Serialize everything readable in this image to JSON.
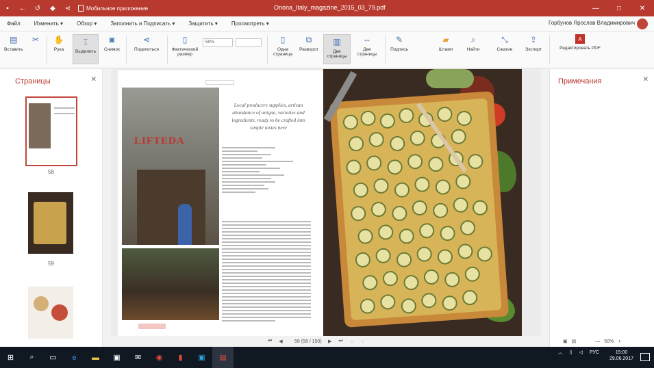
{
  "titlebar": {
    "icons": [
      "save-icon",
      "back-icon",
      "undo-icon",
      "shield-icon",
      "share-icon"
    ],
    "mobile_mode": "Мобильное приложение",
    "title": "Onona_Italy_magazine_2015_03_79.pdf",
    "buttons": [
      "—",
      "□",
      "✕"
    ]
  },
  "menu": {
    "items": [
      "Файл",
      "Изменить ▾",
      "Обзор ▾",
      "Заполнить и Подписать ▾",
      "Защитить ▾",
      "Просмотреть ▾"
    ],
    "user_name": "Горбунов Ярослав Владимирович"
  },
  "ribbon": {
    "buttons": [
      {
        "label": "Вставить",
        "icon": "paste-icon"
      },
      {
        "label": "",
        "icon": "cut-icon"
      },
      {
        "label": "Рука",
        "icon": "hand-icon"
      },
      {
        "label": "Выделить",
        "icon": "select-icon"
      },
      {
        "label": "Снимок",
        "icon": "camera-icon"
      },
      {
        "label": "Поделиться",
        "icon": "share-icon"
      },
      {
        "label": "Фактический размер",
        "icon": "actual-size-icon"
      },
      {
        "label": "Одна страница",
        "icon": "single-page-icon"
      },
      {
        "label": "Разворот",
        "icon": "spread-icon"
      },
      {
        "label": "Две страницы",
        "icon": "two-pages-icon"
      },
      {
        "label": "Две страницы",
        "icon": "two-pages-scroll-icon"
      },
      {
        "label": "Подпись",
        "icon": "signature-icon"
      },
      {
        "label": "Штамп",
        "icon": "stamp-icon"
      },
      {
        "label": "Найти",
        "icon": "search-icon"
      },
      {
        "label": "Сжатие",
        "icon": "compress-icon"
      },
      {
        "label": "Экспорт",
        "icon": "export-icon"
      },
      {
        "label": "Редактировать PDF",
        "icon": "edit-pdf-icon"
      }
    ],
    "zoom_value": "50%"
  },
  "left_panel": {
    "title": "Страницы",
    "thumbnails": [
      {
        "num": "58"
      },
      {
        "num": "59"
      },
      {
        "num": ""
      }
    ]
  },
  "document": {
    "header_tag": "",
    "quote": "Local producers supplies, artisan abundance of unique, varieties and ingredients, ready to be crafted into simple tastes here",
    "sign_text": "LIFTEDA",
    "footer_tag": ""
  },
  "right_panel": {
    "title": "Примечания"
  },
  "status": {
    "page": "58 (58 / 150)",
    "zoom": "50%"
  },
  "taskbar": {
    "apps": [
      "windows-icon",
      "search-icon",
      "task-view-icon",
      "edge-icon",
      "explorer-icon",
      "store-icon",
      "mail-icon",
      "chrome-icon",
      "office-icon",
      "media-icon",
      "pdf-app-icon"
    ],
    "lang": "РУС",
    "time": "15:00",
    "date": "29.06.2017"
  },
  "colors": {
    "accent": "#b83a2e",
    "taskbar": "#101822"
  }
}
